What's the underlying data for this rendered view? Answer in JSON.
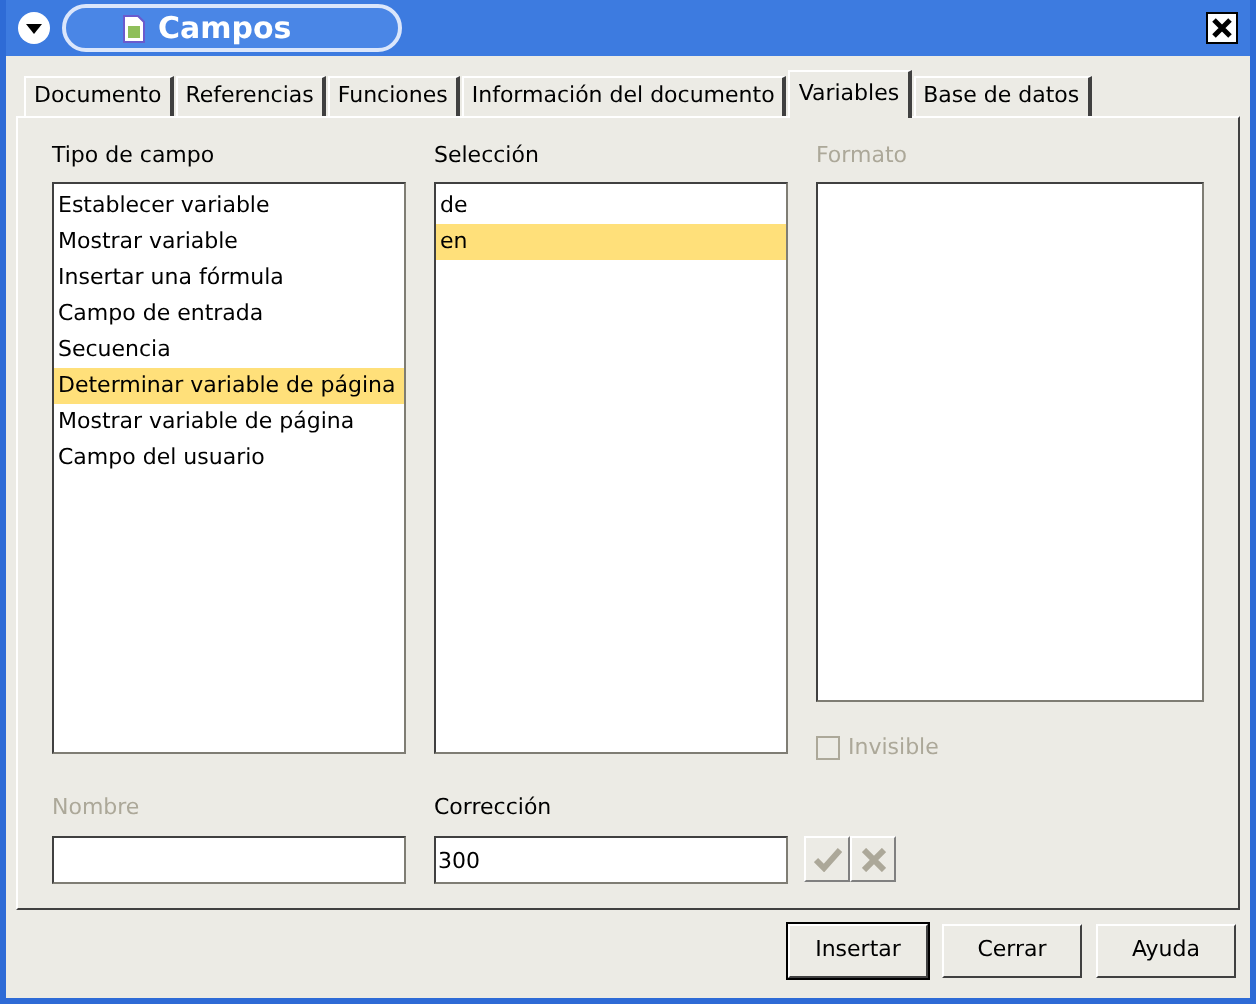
{
  "window": {
    "title": "Campos"
  },
  "tabs": [
    {
      "label": "Documento",
      "selected": false
    },
    {
      "label": "Referencias",
      "selected": false
    },
    {
      "label": "Funciones",
      "selected": false
    },
    {
      "label": "Información del documento",
      "selected": false
    },
    {
      "label": "Variables",
      "selected": true
    },
    {
      "label": "Base de datos",
      "selected": false
    }
  ],
  "type_list": {
    "label": "Tipo de campo",
    "items": [
      {
        "label": "Establecer variable",
        "selected": false
      },
      {
        "label": "Mostrar variable",
        "selected": false
      },
      {
        "label": "Insertar una fórmula",
        "selected": false
      },
      {
        "label": "Campo de entrada",
        "selected": false
      },
      {
        "label": "Secuencia",
        "selected": false
      },
      {
        "label": "Determinar variable de página",
        "selected": true
      },
      {
        "label": "Mostrar variable de página",
        "selected": false
      },
      {
        "label": "Campo del usuario",
        "selected": false
      }
    ]
  },
  "selection_list": {
    "label": "Selección",
    "items": [
      {
        "label": "de",
        "selected": false
      },
      {
        "label": "en",
        "selected": true
      }
    ]
  },
  "format_list": {
    "label": "Formato",
    "disabled": true
  },
  "invisible": {
    "label": "Invisible",
    "checked": false,
    "disabled": true
  },
  "name_field": {
    "label": "Nombre",
    "disabled": true
  },
  "correction_field": {
    "label": "Corrección",
    "value": "300",
    "disabled": false
  },
  "buttons": [
    {
      "label": "Insertar",
      "default": true
    },
    {
      "label": "Cerrar",
      "default": false
    },
    {
      "label": "Ayuda",
      "default": false
    }
  ]
}
